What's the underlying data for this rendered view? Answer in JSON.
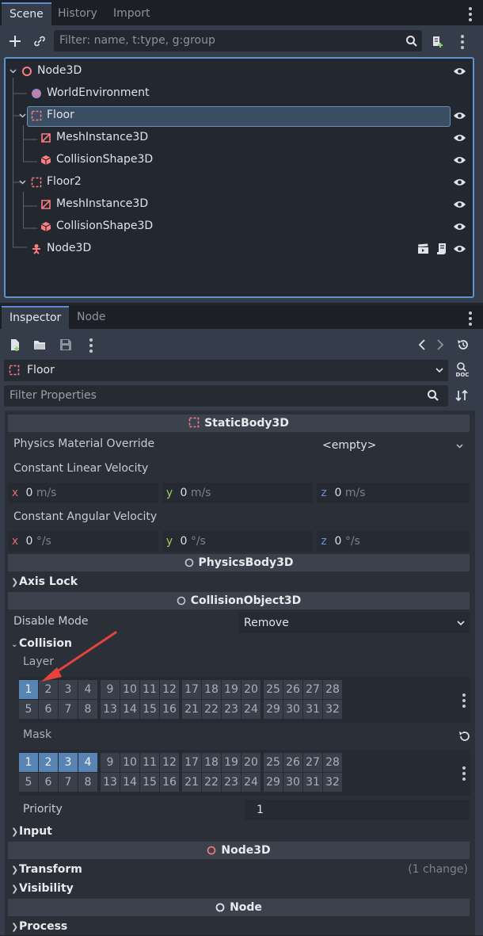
{
  "scene_tabs": [
    {
      "label": "Scene",
      "active": true
    },
    {
      "label": "History",
      "active": false
    },
    {
      "label": "Import",
      "active": false
    }
  ],
  "scene_filter": {
    "placeholder": "Filter: name, t:type, g:group"
  },
  "tree": [
    {
      "label": "Node3D",
      "icon": "node3d-icon",
      "depth": 0,
      "expanded": true
    },
    {
      "label": "WorldEnvironment",
      "icon": "world-environment-icon",
      "depth": 1
    },
    {
      "label": "Floor",
      "icon": "static-body-icon",
      "depth": 1,
      "expanded": true,
      "selected": true
    },
    {
      "label": "MeshInstance3D",
      "icon": "mesh-instance-icon",
      "depth": 2
    },
    {
      "label": "CollisionShape3D",
      "icon": "collision-shape-icon",
      "depth": 2
    },
    {
      "label": "Floor2",
      "icon": "static-body-icon",
      "depth": 1,
      "expanded": true
    },
    {
      "label": "MeshInstance3D",
      "icon": "mesh-instance-icon",
      "depth": 2
    },
    {
      "label": "CollisionShape3D",
      "icon": "collision-shape-icon",
      "depth": 2
    },
    {
      "label": "Node3D",
      "icon": "character-body-icon",
      "depth": 1,
      "extra_icons": [
        "clapperboard-icon",
        "script-icon"
      ]
    }
  ],
  "inspector_tabs": [
    {
      "label": "Inspector",
      "active": true
    },
    {
      "label": "Node",
      "active": false
    }
  ],
  "object_selector": {
    "value": "Floor",
    "doc_label": "DOC"
  },
  "property_filter": {
    "placeholder": "Filter Properties"
  },
  "sections": {
    "static_body": "StaticBody3D",
    "physics_body": "PhysicsBody3D",
    "collision_object": "CollisionObject3D",
    "node3d": "Node3D",
    "node": "Node"
  },
  "props": {
    "physics_material_override": {
      "label": "Physics Material Override",
      "value": "<empty>"
    },
    "linear_velocity": {
      "label": "Constant Linear Velocity",
      "x": "0",
      "y": "0",
      "z": "0",
      "unit": "m/s"
    },
    "angular_velocity": {
      "label": "Constant Angular Velocity",
      "x": "0",
      "y": "0",
      "z": "0",
      "unit": "°/s"
    },
    "axis_lock": "Axis Lock",
    "disable_mode": {
      "label": "Disable Mode",
      "value": "Remove"
    },
    "collision": "Collision",
    "layer": {
      "label": "Layer",
      "active": [
        1
      ]
    },
    "mask": {
      "label": "Mask",
      "active": [
        1,
        2,
        3,
        4
      ]
    },
    "priority": {
      "label": "Priority",
      "value": "1"
    },
    "input": "Input",
    "transform": {
      "label": "Transform",
      "note": "(1 change)"
    },
    "visibility": "Visibility",
    "process": "Process"
  },
  "axis_labels": {
    "x": "x",
    "y": "y",
    "z": "z"
  },
  "colors": {
    "accent": "#5884b3",
    "selection": "#3b4d63",
    "node_red": "#fc7f7f",
    "x_axis": "#e26b6b",
    "y_axis": "#9ad05a",
    "z_axis": "#6f8fd8",
    "annotation_arrow": "#e8423c"
  }
}
